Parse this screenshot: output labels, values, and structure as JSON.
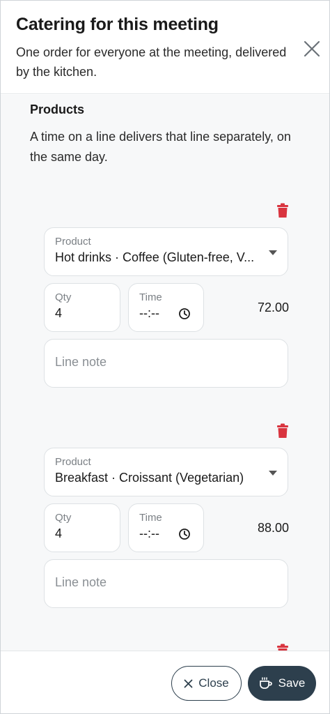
{
  "dialog": {
    "title": "Catering for this meeting",
    "subtitle": "One order for everyone at the meeting, delivered by the kitchen.",
    "close_icon": "close-icon"
  },
  "products": {
    "title": "Products",
    "help": "A time on a line delivers that line separately, on the same day.",
    "lines": [
      {
        "product_label": "Product",
        "product_value": "Hot drinks · Coffee (Gluten-free, V...",
        "qty_label": "Qty",
        "qty_value": "4",
        "time_label": "Time",
        "time_value": "--:--",
        "amount": "72.00",
        "note_placeholder": "Line note"
      },
      {
        "product_label": "Product",
        "product_value": "Breakfast · Croissant (Vegetarian)",
        "qty_label": "Qty",
        "qty_value": "4",
        "time_label": "Time",
        "time_value": "--:--",
        "amount": "88.00",
        "note_placeholder": "Line note"
      }
    ]
  },
  "footer": {
    "close_label": "Close",
    "save_label": "Save"
  },
  "colors": {
    "accent": "#2d3f4d",
    "danger": "#d9343f",
    "body_bg": "#f7f8f9"
  }
}
